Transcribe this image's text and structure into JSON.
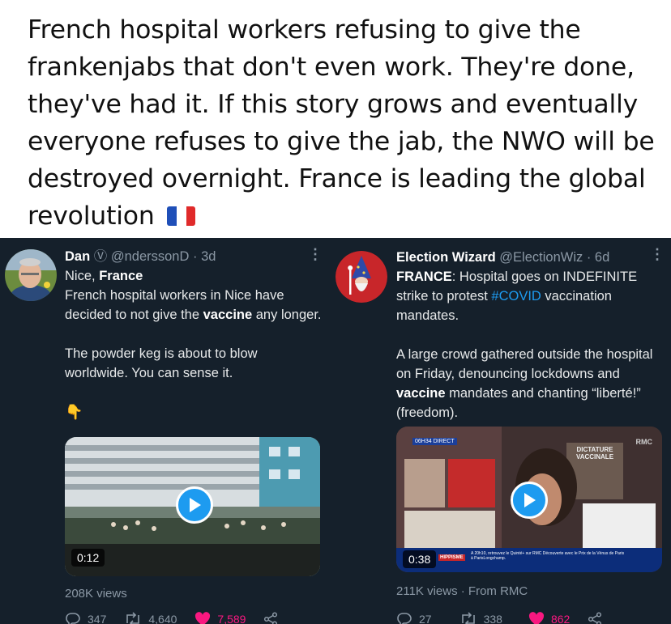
{
  "headline": {
    "text": "French hospital workers refusing to give the frankenjabs that don't even work. They're done, they've had it. If this story grows and eventually everyone refuses to give the jab, the NWO will be destroyed overnight. France is leading the global revolution",
    "flag_icon": "france-flag-icon",
    "flag_colors": [
      "#1f4fb8",
      "#ffffff",
      "#e02a2a"
    ]
  },
  "colors": {
    "background": "#15202b",
    "accent": "#1d9bf0",
    "like": "#f91880",
    "muted": "#8b98a5"
  },
  "tweet_left": {
    "name": "Dan",
    "badge_icon": "circled-v-icon",
    "badge": "Ⓥ",
    "handle": "@ndersson D",
    "handle_display": "@nderssonD",
    "age": "· 3d",
    "location_prefix": "Nice, ",
    "location_bold": "France",
    "p1_a": "French hospital workers in Nice have decided to not give the ",
    "p1_bold": "vaccine",
    "p1_b": " any longer.",
    "p2": "The powder keg is about to blow worldwide. You can sense it.",
    "emoji": "👇",
    "video_time": "0:12",
    "views": "208K views",
    "replies": "347",
    "retweets": "4,640",
    "likes": "7,589"
  },
  "tweet_right": {
    "name": "Election Wizard",
    "handle": "@ElectionWiz",
    "age": "· 6d",
    "p1_bold": "FRANCE",
    "p1_a": ": Hospital goes on INDEFINITE strike to protest ",
    "p1_tag": "#COVID",
    "p1_b": " vaccination mandates.",
    "p2_a": "A large crowd gathered outside the hospital on Friday, denouncing lockdowns and ",
    "p2_bold": "vaccine",
    "p2_b": " mandates and chanting “liberté!” (freedom).",
    "video_time": "0:38",
    "channel_tag": "RMC",
    "sign_text": "DICTATURE VACCINALE",
    "live_tag": "06H34 DIRECT",
    "ticker_label": "HIPPISME",
    "ticker_text": "A 20h10, retrouvez le Quinté+ sur RMC Découverte avec le Prix de la Vénus de Paris à ParisLongchamp.",
    "views": "211K views",
    "source": "· From RMC",
    "replies": "27",
    "retweets": "338",
    "likes": "862"
  }
}
